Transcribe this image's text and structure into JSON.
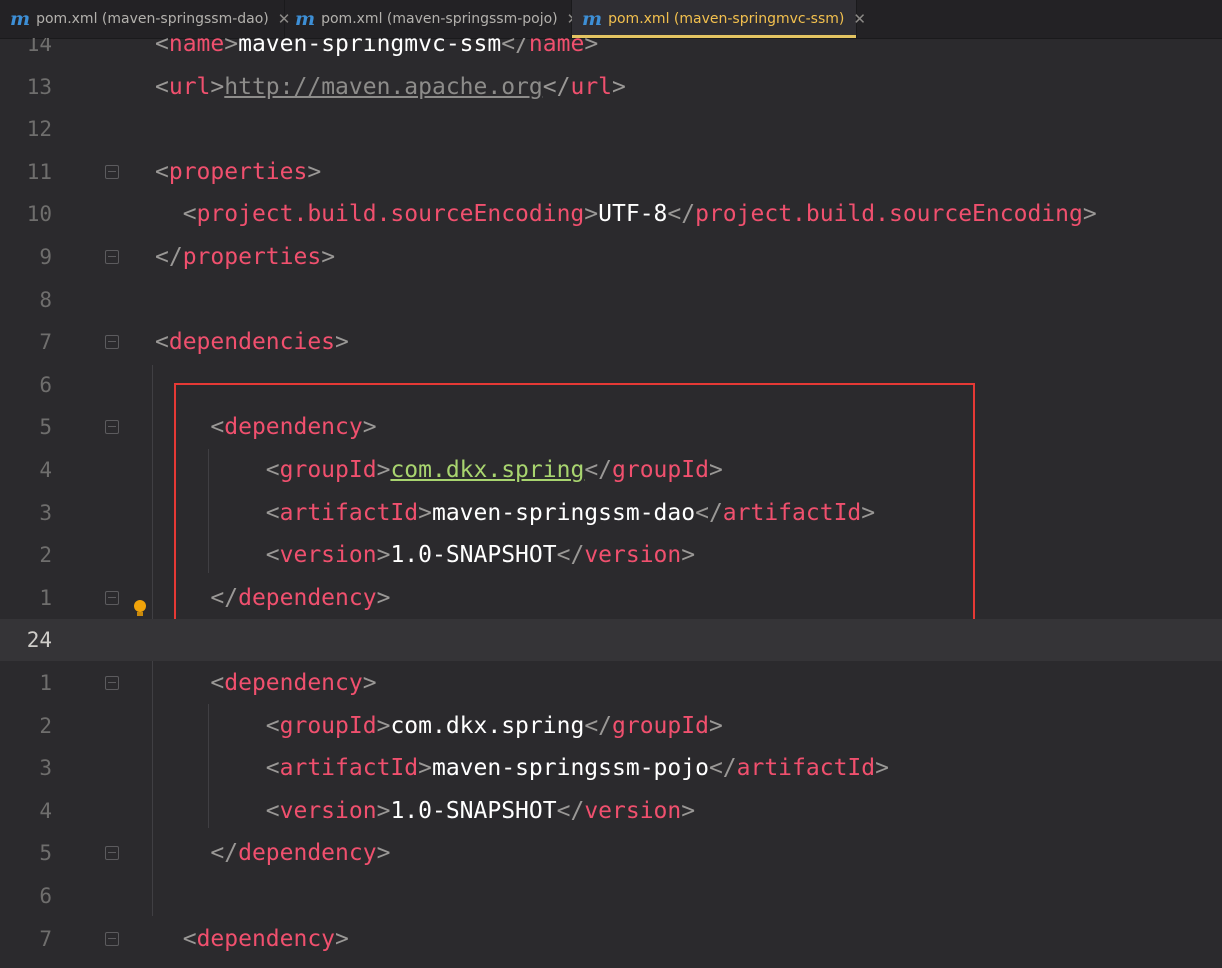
{
  "tabs": [
    {
      "icon": "m",
      "label": "pom.xml (maven-springssm-dao)",
      "close": "✕"
    },
    {
      "icon": "m",
      "label": "pom.xml (maven-springssm-pojo)",
      "close": "✕"
    },
    {
      "icon": "m",
      "label": "pom.xml (maven-springmvc-ssm)",
      "close": "✕"
    }
  ],
  "lines": [
    {
      "num": "14",
      "indent": "",
      "tag": "name",
      "value": "maven-springmvc-ssm"
    },
    {
      "num": "13",
      "indent": "",
      "tag": "url",
      "value": "http://maven.apache.org"
    },
    {
      "num": "12"
    },
    {
      "num": "11",
      "indent": "",
      "open": "properties"
    },
    {
      "num": "10",
      "indent": "  ",
      "tag": "project.build.sourceEncoding",
      "value": "UTF-8"
    },
    {
      "num": "9",
      "indent": "",
      "close": "properties"
    },
    {
      "num": "8"
    },
    {
      "num": "7",
      "indent": "",
      "open": "dependencies"
    },
    {
      "num": "6"
    },
    {
      "num": "5",
      "indent": "    ",
      "open": "dependency"
    },
    {
      "num": "4",
      "indent": "        ",
      "tag": "groupId",
      "value": "com.dkx.spring"
    },
    {
      "num": "3",
      "indent": "        ",
      "tag": "artifactId",
      "value": "maven-springssm-dao"
    },
    {
      "num": "2",
      "indent": "        ",
      "tag": "version",
      "value": "1.0-SNAPSHOT"
    },
    {
      "num": "1",
      "indent": "    ",
      "close": "dependency"
    },
    {
      "num": "24"
    },
    {
      "num": "1",
      "indent": "    ",
      "open": "dependency"
    },
    {
      "num": "2",
      "indent": "        ",
      "tag": "groupId",
      "value": "com.dkx.spring"
    },
    {
      "num": "3",
      "indent": "        ",
      "tag": "artifactId",
      "value": "maven-springssm-pojo"
    },
    {
      "num": "4",
      "indent": "        ",
      "tag": "version",
      "value": "1.0-SNAPSHOT"
    },
    {
      "num": "5",
      "indent": "    ",
      "close": "dependency"
    },
    {
      "num": "6"
    },
    {
      "num": "7",
      "indent": "  ",
      "open": "dependency"
    }
  ],
  "colors": {
    "tag": "#f0506e",
    "bracket": "#9a9896",
    "text": "#ffffff",
    "link": "#a8d46f",
    "active_tab": "#f2c04e",
    "highlight_box": "#e53935"
  }
}
